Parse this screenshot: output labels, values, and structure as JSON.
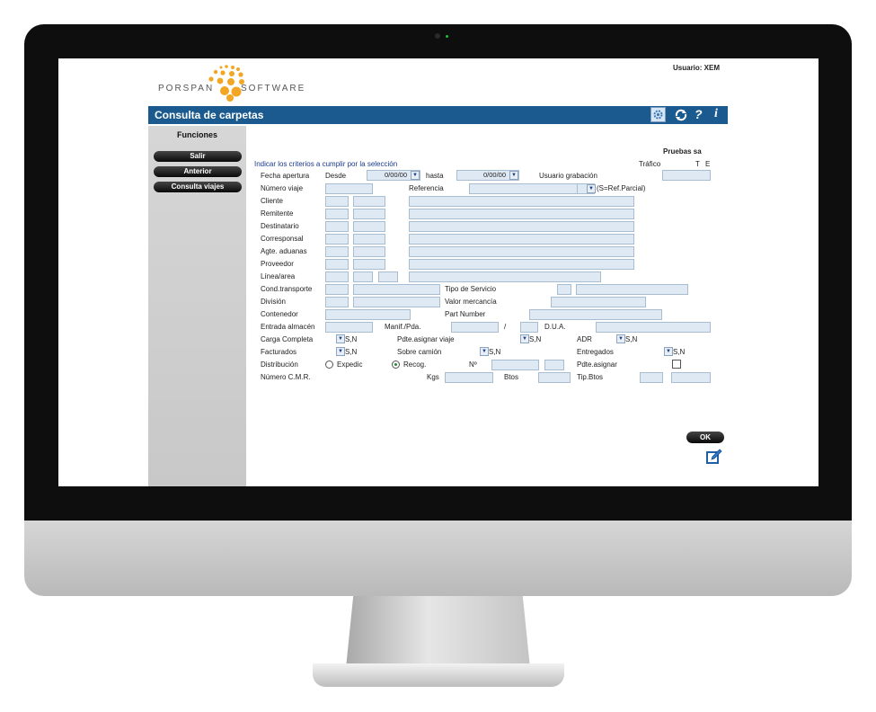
{
  "header": {
    "logo_word1": "Porspan",
    "logo_word2": "Software",
    "user_label": "Usuario: XEM",
    "page_title": "Consulta de carpetas",
    "help_label": "?",
    "info_label": "i"
  },
  "sidebar": {
    "title": "Funciones",
    "buttons": [
      "Salir",
      "Anterior",
      "Consulta viajes"
    ]
  },
  "form": {
    "company": "Pruebas sa",
    "instruction": "Indicar los criterios a cumplir por la selección",
    "trafico_label": "Tráfico",
    "trafico_t": "T",
    "trafico_e": "E",
    "labels": {
      "fecha_apertura": "Fecha apertura",
      "desde": "Desde",
      "hasta": "hasta",
      "usuario_grabacion": "Usuario grabación",
      "numero_viaje": "Número viaje",
      "referencia": "Referencia",
      "ref_parcial": "(S=Ref.Parcial)",
      "cliente": "Cliente",
      "remitente": "Remitente",
      "destinatario": "Destinatario",
      "corresponsal": "Corresponsal",
      "agte_aduanas": "Agte. aduanas",
      "proveedor": "Proveedor",
      "linea_area": "Línea/area",
      "cond_transporte": "Cond.transporte",
      "tipo_servicio": "Tipo de Servicio",
      "division": "División",
      "valor_mercancia": "Valor mercancía",
      "contenedor": "Contenedor",
      "part_number": "Part Number",
      "entrada_almacen": "Entrada almacén",
      "manif_pda": "Manif./Pda.",
      "slash": "/",
      "dua": "D.U.A.",
      "carga_completa": "Carga Completa",
      "pdte_asignar_viaje": "Pdte.asignar viaje",
      "adr": "ADR",
      "facturados": "Facturados",
      "sobre_camion": "Sobre camión",
      "entregados": "Entregados",
      "distribucion": "Distribución",
      "expedic": "Expedic",
      "recog": "Recog.",
      "numero": "Nº",
      "pdte_asignar": "Pdte.asignar",
      "numero_cmr": "Número C.M.R.",
      "kgs": "Kgs",
      "btos": "Btos",
      "tip_btos": "Tip.Btos"
    },
    "values": {
      "fecha_desde": "0/00/00",
      "fecha_hasta": "0/00/00",
      "sn": "S,N"
    },
    "ok_label": "OK"
  },
  "colors": {
    "title_bar": "#1a5a8e",
    "field_bg": "#dfe9f3",
    "sidebar_bg": "#cfcfcf",
    "logo_orange": "#f2a623"
  }
}
